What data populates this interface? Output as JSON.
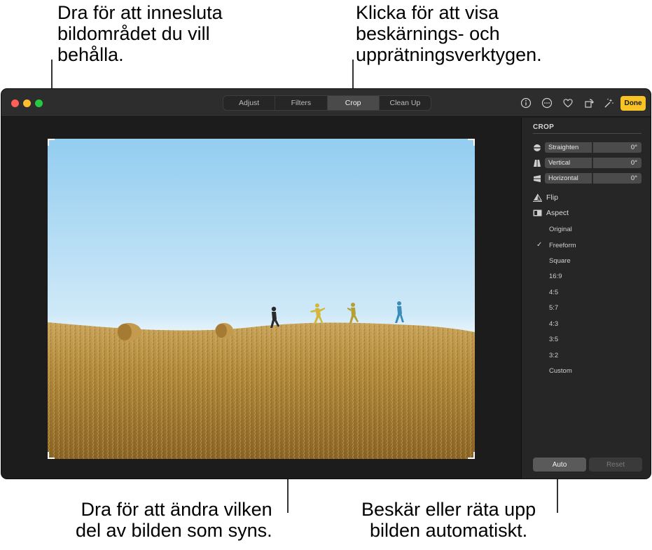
{
  "callouts": {
    "top_left": "Dra för att innesluta\nbildområdet du vill\nbehålla.",
    "top_right": "Klicka för att visa\nbeskärnings- och\nupprätningsverktygen.",
    "bottom_left": "Dra för att ändra vilken\ndel av bilden som syns.",
    "bottom_right": "Beskär eller räta upp\nbilden automatiskt."
  },
  "toolbar": {
    "tabs": [
      "Adjust",
      "Filters",
      "Crop",
      "Clean Up"
    ],
    "active_tab": "Crop",
    "icons": [
      "info-icon",
      "more-icon",
      "heart-icon",
      "rotate-icon",
      "magic-wand-icon"
    ],
    "done_label": "Done"
  },
  "colors": {
    "accent": "#f7c325",
    "window_bg": "#1f1f1f",
    "sidebar_bg": "#262626"
  },
  "sidebar": {
    "title": "CROP",
    "sliders": [
      {
        "label": "Straighten",
        "value": "0°"
      },
      {
        "label": "Vertical",
        "value": "0°"
      },
      {
        "label": "Horizontal",
        "value": "0°"
      }
    ],
    "flip_label": "Flip",
    "aspect_label": "Aspect",
    "aspect_options": [
      "Original",
      "Freeform",
      "Square",
      "16:9",
      "4:5",
      "5:7",
      "4:3",
      "3:5",
      "3:2",
      "Custom"
    ],
    "selected_aspect": "Freeform",
    "auto_label": "Auto",
    "reset_label": "Reset"
  }
}
